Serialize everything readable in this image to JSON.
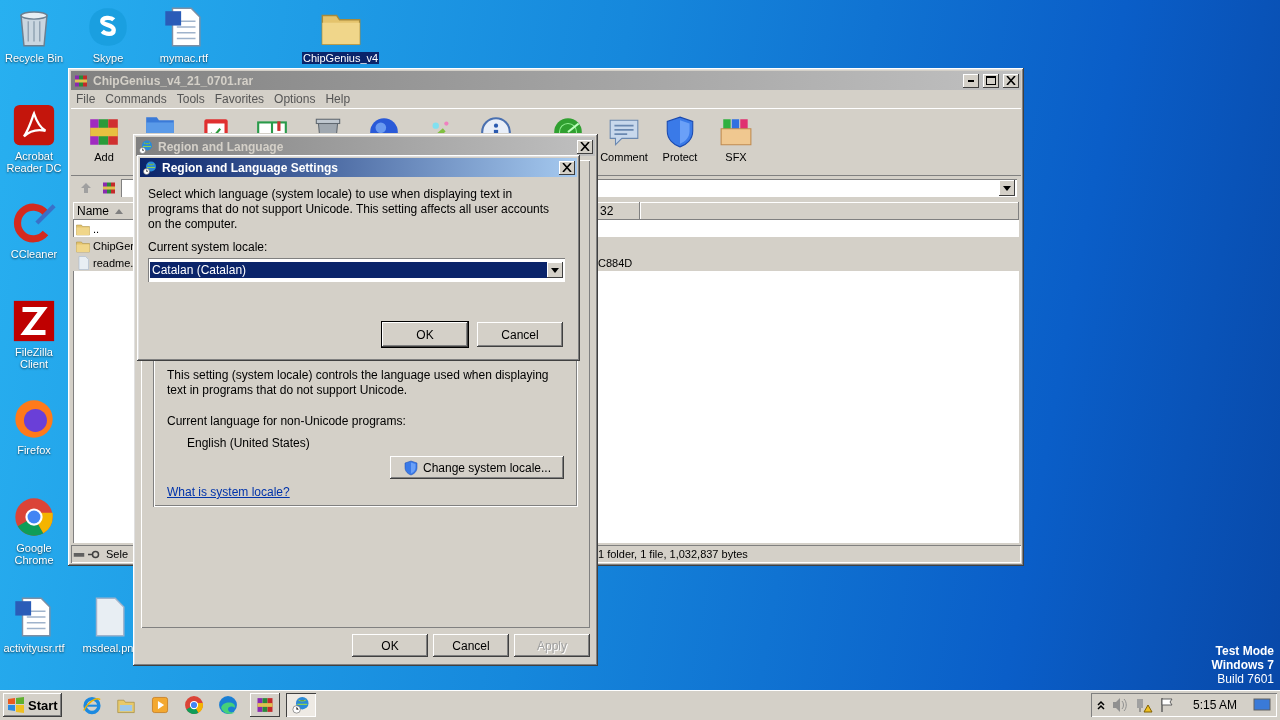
{
  "desktop": {
    "icons": [
      {
        "label": "Recycle Bin",
        "kind": "bin",
        "selected": false
      },
      {
        "label": "Skype",
        "kind": "skype",
        "selected": false
      },
      {
        "label": "mymac.rtf",
        "kind": "word",
        "selected": false
      },
      {
        "label": "ChipGenius_v4",
        "kind": "folder",
        "selected": true
      },
      {
        "label": "Acrobat Reader DC",
        "kind": "acrobat",
        "selected": false
      },
      {
        "label": "CCleaner",
        "kind": "ccleaner",
        "selected": false
      },
      {
        "label": "FileZilla Client",
        "kind": "filezilla",
        "selected": false
      },
      {
        "label": "Firefox",
        "kind": "firefox",
        "selected": false
      },
      {
        "label": "Google Chrome",
        "kind": "chrome",
        "selected": false
      },
      {
        "label": "activityusr.rtf",
        "kind": "word",
        "selected": false
      },
      {
        "label": "msdeal.pn",
        "kind": "blank",
        "selected": false
      }
    ],
    "system_notice": [
      "Test Mode",
      "Windows 7",
      "Build 7601"
    ]
  },
  "archive_window": {
    "title": "ChipGenius_v4_21_0701.rar",
    "active": false,
    "menu": [
      "File",
      "Commands",
      "Tools",
      "Favorites",
      "Options",
      "Help"
    ],
    "toolbar": [
      {
        "kind": "add",
        "label": "Add"
      },
      {
        "kind": "extract"
      },
      {
        "kind": "test"
      },
      {
        "kind": "view"
      },
      {
        "kind": "delete"
      },
      {
        "kind": "find"
      },
      {
        "kind": "wizard"
      },
      {
        "kind": "info"
      },
      {
        "kind": "scan"
      },
      {
        "kind": "comment",
        "label": "Comment"
      },
      {
        "kind": "protect",
        "label": "Protect"
      },
      {
        "kind": "sfx",
        "label": "SFX"
      }
    ],
    "columns": [
      "Name",
      "32"
    ],
    "rows": [
      {
        "name": "..",
        "kind": "up",
        "selected": false
      },
      {
        "name": "ChipGer",
        "kind": "folder",
        "selected": true
      },
      {
        "name": "readme.",
        "kind": "file",
        "column_2": "C884D",
        "selected": true
      }
    ],
    "status_left": "Sele",
    "status_right": "1 folder, 1 file, 1,032,837 bytes"
  },
  "region_dialog": {
    "title": "Region and Language",
    "active": false,
    "description": "This setting (system locale) controls the language used when displaying text in programs that do not support Unicode.",
    "current_language_label": "Current language for non-Unicode programs:",
    "current_language": "English (United States)",
    "change_button": "Change system locale...",
    "help_link": "What is system locale?",
    "buttons": [
      {
        "label": "OK",
        "disabled": false
      },
      {
        "label": "Cancel",
        "disabled": false
      },
      {
        "label": "Apply",
        "disabled": true
      }
    ]
  },
  "locale_dialog": {
    "title": "Region and Language Settings",
    "active": true,
    "description": "Select which language (system locale) to use when displaying text in programs that do not support Unicode. This setting affects all user accounts on the computer.",
    "locale_label": "Current system locale:",
    "locale_value": "Catalan (Catalan)",
    "buttons": [
      {
        "label": "OK",
        "default": true
      },
      {
        "label": "Cancel",
        "default": false
      }
    ]
  },
  "taskbar": {
    "start": "Start",
    "quick_launch": [
      {
        "kind": "ie"
      },
      {
        "kind": "explorer"
      },
      {
        "kind": "media"
      },
      {
        "kind": "chrome"
      },
      {
        "kind": "edge"
      }
    ],
    "tasks": [
      {
        "kind": "winrar",
        "selected": false
      },
      {
        "kind": "globe",
        "selected": true
      }
    ],
    "clock": "5:15 AM"
  }
}
